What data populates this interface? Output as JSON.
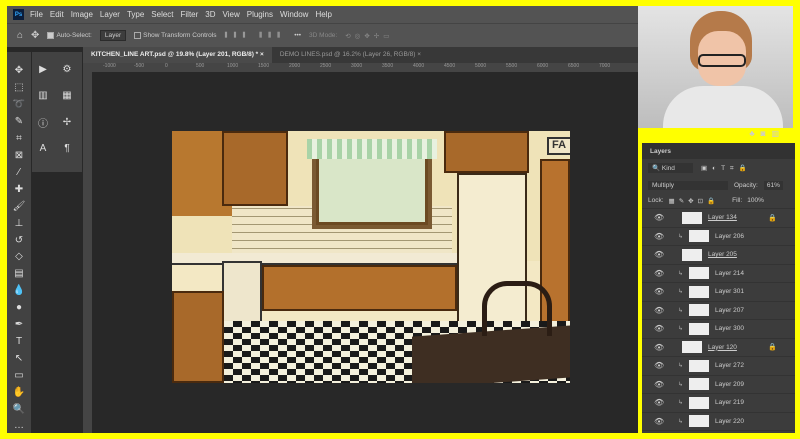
{
  "app": {
    "menu": [
      "File",
      "Edit",
      "Image",
      "Layer",
      "Type",
      "Select",
      "Filter",
      "3D",
      "View",
      "Plugins",
      "Window",
      "Help"
    ],
    "logo": "Ps"
  },
  "options": {
    "auto_select_label": "Auto-Select:",
    "auto_select_value": "Layer",
    "show_transform_label": "Show Transform Controls",
    "more": "•••",
    "mode_3d": "3D Mode:"
  },
  "tabs": [
    {
      "label": "KITCHEN_LINE ART.psd @ 19.8% (Layer 201, RGB/8) *",
      "close": "×"
    },
    {
      "label": "DEMO LINES.psd @ 16.2% (Layer 26, RGB/8)",
      "close": "×"
    }
  ],
  "ruler": [
    "-1000",
    "-500",
    "0",
    "500",
    "1000",
    "1500",
    "2000",
    "2500",
    "3000",
    "3500",
    "4000",
    "4500",
    "5000",
    "5500",
    "6000",
    "6500",
    "7000"
  ],
  "layers_panel": {
    "title": "Layers",
    "filter": "Kind",
    "blend_mode": "Multiply",
    "opacity_label": "Opacity:",
    "opacity": "61%",
    "lock_label": "Lock:",
    "fill_label": "Fill:",
    "fill": "100%",
    "layers": [
      {
        "name": "Layer 134",
        "group": true,
        "locked": true
      },
      {
        "name": "Layer 206",
        "clipped": true
      },
      {
        "name": "Layer 205",
        "group": true
      },
      {
        "name": "Layer 214",
        "clipped": true
      },
      {
        "name": "Layer 301",
        "clipped": true
      },
      {
        "name": "Layer 207",
        "clipped": true
      },
      {
        "name": "Layer 300",
        "clipped": true
      },
      {
        "name": "Layer 120",
        "group": true,
        "locked": true
      },
      {
        "name": "Layer 272",
        "clipped": true
      },
      {
        "name": "Layer 209",
        "clipped": true
      },
      {
        "name": "Layer 219",
        "clipped": true
      },
      {
        "name": "Layer 220",
        "clipped": true
      }
    ]
  },
  "canvas": {
    "sign_text": "FA"
  },
  "colors": {
    "frame": "#ffff00",
    "workspace": "#282828",
    "panel": "#535353"
  }
}
